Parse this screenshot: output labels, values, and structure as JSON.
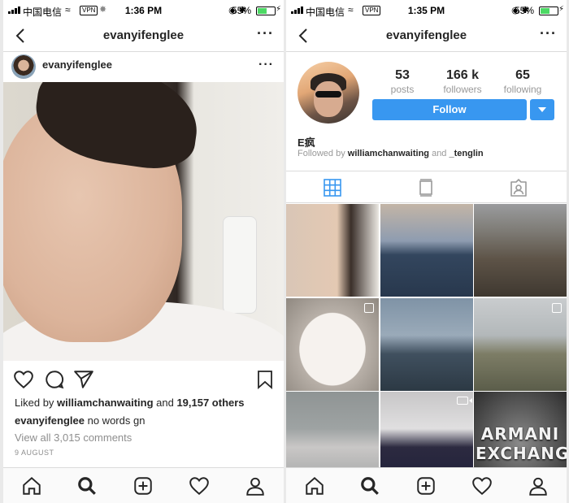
{
  "left": {
    "status": {
      "carrier": "中国电信",
      "vpn": "VPN",
      "time": "1:36 PM",
      "battery": "55%",
      "battery_level": 0.55
    },
    "nav": {
      "title": "evanyifenglee"
    },
    "post": {
      "username": "evanyifenglee",
      "liked_by_prefix": "Liked by ",
      "liked_by_user": "williamchanwaiting",
      "liked_by_mid": " and ",
      "liked_by_others": "19,157 others",
      "caption_user": "evanyifenglee",
      "caption_text": " no words gn",
      "comments": "View all 3,015 comments",
      "date": "9 AUGUST"
    },
    "tabbar": [
      "home-icon",
      "search-icon",
      "add-icon",
      "heart-icon",
      "profile-icon"
    ]
  },
  "right": {
    "status": {
      "carrier": "中国电信",
      "vpn": "VPN",
      "time": "1:35 PM",
      "battery": "55%",
      "battery_level": 0.55
    },
    "nav": {
      "title": "evanyifenglee"
    },
    "profile": {
      "posts_num": "53",
      "posts_label": "posts",
      "followers_num": "166 k",
      "followers_label": "followers",
      "following_num": "65",
      "following_label": "following",
      "follow_button": "Follow",
      "name": "E疯",
      "followed_by_prefix": "Followed by ",
      "followed_by_user1": "williamchanwaiting",
      "followed_by_mid": " and ",
      "followed_by_user2": "_tenglin"
    },
    "grid_overlay_text": "ARMANI EXCHANGE",
    "tabbar": [
      "home-icon",
      "search-icon",
      "add-icon",
      "heart-icon",
      "profile-icon"
    ]
  },
  "colors": {
    "accent": "#3897f0",
    "muted": "#8e8e8e",
    "text": "#262626",
    "divider": "#dbdbdb"
  }
}
